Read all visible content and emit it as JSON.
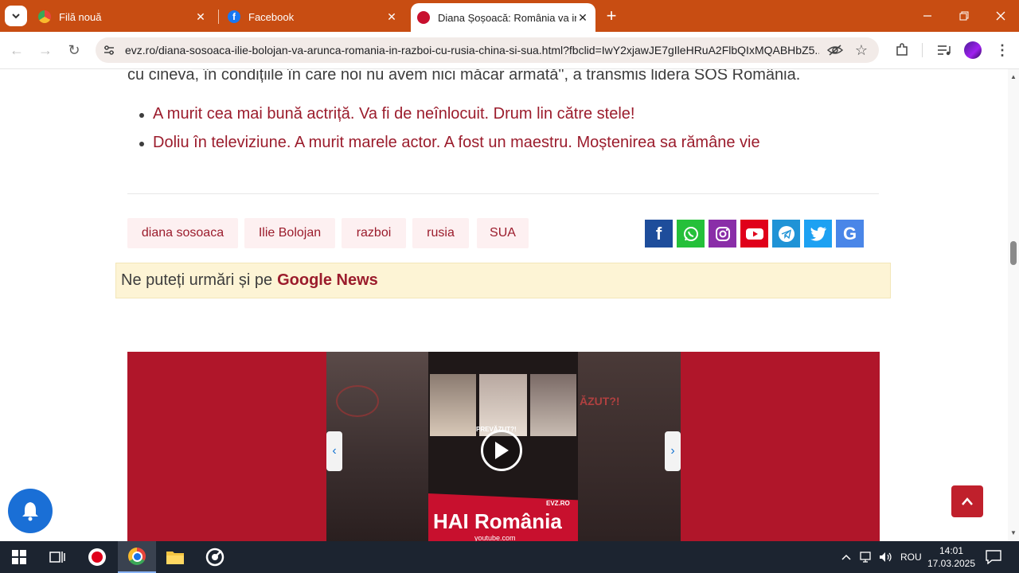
{
  "browser": {
    "tabs": [
      {
        "title": "Filă nouă",
        "icon": "chrome-icon"
      },
      {
        "title": "Facebook",
        "icon": "facebook-icon"
      },
      {
        "title": "Diana Șoșoacă: România va intra",
        "icon": "evz-icon",
        "active": true
      }
    ],
    "url": "evz.ro/diana-sosoaca-ilie-bolojan-va-arunca-romania-in-razboi-cu-rusia-china-si-sua.html?fbclid=IwY2xjawJE7gIleHRuA2FlbQIxMQABHbZ5..."
  },
  "article": {
    "paragraph_tail": "cu cineva, în condițiile în care noi nu avem nici măcar armată\", a transmis lidera SOS România.",
    "related": [
      "A murit cea mai bună actriță. Va fi de neînlocuit. Drum lin către stele!",
      "Doliu în televiziune. A murit marele actor. A fost un maestru. Moștenirea sa rămâne vie"
    ],
    "tags": [
      "diana sosoaca",
      "Ilie Bolojan",
      "razboi",
      "rusia",
      "SUA"
    ],
    "social": [
      {
        "name": "facebook-share",
        "color": "#1e4d9b"
      },
      {
        "name": "whatsapp-share",
        "color": "#25c03a"
      },
      {
        "name": "instagram-share",
        "color": "#8a2ea8"
      },
      {
        "name": "youtube-share",
        "color": "#e0001a"
      },
      {
        "name": "telegram-share",
        "color": "#1f93d6"
      },
      {
        "name": "twitter-share",
        "color": "#1da1f2"
      },
      {
        "name": "google-share",
        "color": "#4a86e8"
      }
    ],
    "google_news_prefix": "Ne puteți urmări și pe",
    "google_news_link": "Google News"
  },
  "video": {
    "banner_text": "HAI România",
    "brand": "EVZ.RO",
    "sub_caption": "youtube.com",
    "overlay_text": "PREVĂZUT?!",
    "side_text": "ĂZUT?!"
  },
  "taskbar": {
    "language": "ROU",
    "time": "14:01",
    "date": "17.03.2025"
  },
  "colors": {
    "tabbar": "#c84d12",
    "accent": "#9b1c2c",
    "video_bg": "#b0162a"
  }
}
